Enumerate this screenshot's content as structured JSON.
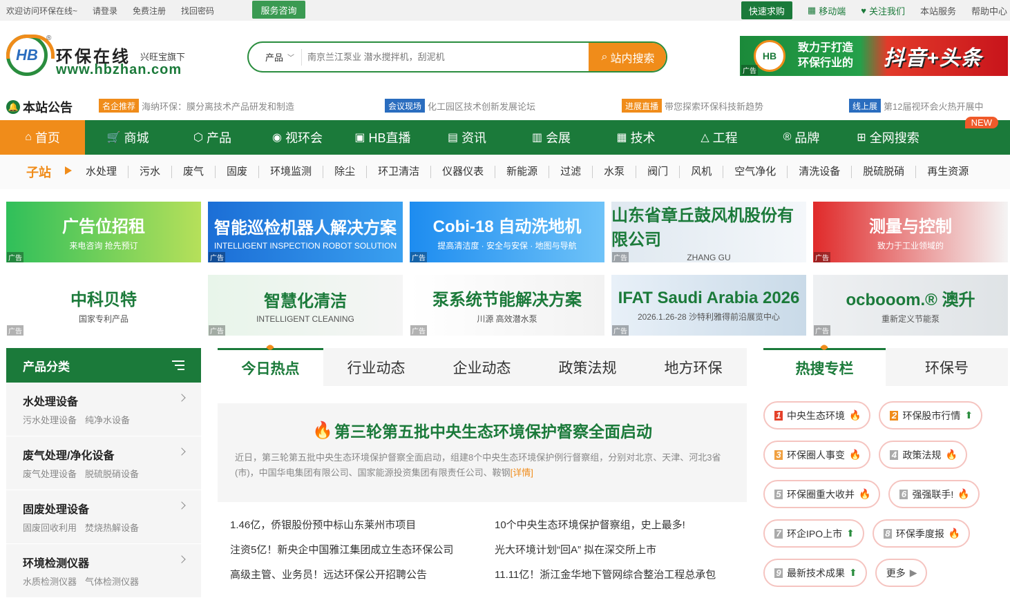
{
  "topbar": {
    "welcome": "欢迎访问环保在线~",
    "login": "请登录",
    "register": "免费注册",
    "find_pwd": "找回密码",
    "service": "服务咨询",
    "quick_buy": "快速求购",
    "mobile": "移动端",
    "follow": "关注我们",
    "site_service": "本站服务",
    "help": "帮助中心"
  },
  "logo": {
    "mark": "HB",
    "cn": "环保在线",
    "sub": "兴旺宝旗下",
    "url": "www.hbzhan.com"
  },
  "search": {
    "category": "产品",
    "placeholder": "南京兰江泵业 潜水搅拌机，刮泥机",
    "button": "站内搜索"
  },
  "top_banner": {
    "badge": "HB",
    "line1": "致力于打造",
    "line2": "环保行业的",
    "slogan": "抖音+头条",
    "ad": "广告"
  },
  "notice": {
    "title": "本站公告",
    "items": [
      {
        "tag": "名企推荐",
        "text": "海纳环保：膜分离技术产品研发和制造",
        "color": "#f08c1a"
      },
      {
        "tag": "会议现场",
        "text": "化工园区技术创新发展论坛",
        "color": "#2a6dbf"
      },
      {
        "tag": "进展直播",
        "text": "带您探索环保科技新趋势",
        "color": "#f08c1a"
      },
      {
        "tag": "线上展",
        "text": "第12届视环会火热开展中",
        "color": "#2a6dbf"
      }
    ]
  },
  "nav": {
    "items": [
      "首页",
      "商城",
      "产品",
      "视环会",
      "HB直播",
      "资讯",
      "会展",
      "技术",
      "工程",
      "品牌",
      "全网搜索"
    ],
    "new_badge": "NEW"
  },
  "subnav": {
    "label": "子站",
    "items": [
      "水处理",
      "污水",
      "废气",
      "固废",
      "环境监测",
      "除尘",
      "环卫清洁",
      "仪器仪表",
      "新能源",
      "过滤",
      "水泵",
      "阀门",
      "风机",
      "空气净化",
      "清洗设备",
      "脱硫脱硝",
      "再生资源"
    ]
  },
  "ads": [
    [
      {
        "t1": "广告位招租",
        "t2": "来电咨询 抢先预订",
        "bg": "linear-gradient(90deg,#2fbf5a,#b6e05a)"
      },
      {
        "t1": "智能巡检机器人解决方案",
        "t2": "INTELLIGENT INSPECTION ROBOT SOLUTION",
        "bg": "linear-gradient(90deg,#1b6ed6,#3aa0f0)"
      },
      {
        "t1": "Cobi-18 自动洗地机",
        "t2": "提高清洁度 · 安全与安保 · 地图与导航",
        "bg": "linear-gradient(90deg,#1d8cf0,#6fc3f8)"
      },
      {
        "t1": "山东省章丘鼓风机股份有限公司",
        "t2": "ZHANG GU",
        "bg": "linear-gradient(90deg,#dfe8f0,#f4f7fa)",
        "dark": true
      },
      {
        "t1": "测量与控制",
        "t2": "致力于工业领域的",
        "bg": "linear-gradient(90deg,#e02a2a,#f4f4f4)"
      }
    ],
    [
      {
        "t1": "中科贝特",
        "t2": "国家专利产品",
        "bg": "linear-gradient(90deg,#ffffff,#ffffff)",
        "dark": true
      },
      {
        "t1": "智慧化清洁",
        "t2": "INTELLIGENT CLEANING",
        "bg": "linear-gradient(90deg,#e8f5ea,#f5f5f5)",
        "dark": true
      },
      {
        "t1": "泵系统节能解决方案",
        "t2": "川源 高效潜水泵",
        "bg": "linear-gradient(90deg,#ffffff,#f2f2f2)",
        "dark": true
      },
      {
        "t1": "IFAT Saudi Arabia 2026",
        "t2": "2026.1.26-28 沙特利雅得前沿展览中心",
        "bg": "linear-gradient(90deg,#e8f0f8,#c9dae8)",
        "dark": true
      },
      {
        "t1": "ocbooom.® 澳升",
        "t2": "重新定义节能泵",
        "bg": "linear-gradient(90deg,#eef0f2,#dfe3e6)",
        "dark": true
      }
    ]
  ],
  "ad_label": "广告",
  "category": {
    "title": "产品分类",
    "rows": [
      {
        "t": "水处理设备",
        "s1": "污水处理设备",
        "s2": "纯净水设备"
      },
      {
        "t": "废气处理/净化设备",
        "s1": "废气处理设备",
        "s2": "脱硫脱硝设备"
      },
      {
        "t": "固废处理设备",
        "s1": "固废回收利用",
        "s2": "焚烧热解设备"
      },
      {
        "t": "环境检测仪器",
        "s1": "水质检测仪器",
        "s2": "气体检测仪器"
      }
    ]
  },
  "news": {
    "tabs": [
      "今日热点",
      "行业动态",
      "企业动态",
      "政策法规",
      "地方环保"
    ],
    "headline": "第三轮第五批中央生态环境保护督察全面启动",
    "summary": "近日，第三轮第五批中央生态环境保护督察全面启动，组建8个中央生态环境保护例行督察组，分别对北京、天津、河北3省(市)，中国华电集团有限公司、国家能源投资集团有限责任公司、鞍钢",
    "more": "[详情]",
    "items": [
      "1.46亿，侨银股份预中标山东莱州市项目",
      "10个中央生态环境保护督察组，史上最多!",
      "注资5亿！新央企中国雅江集团成立生态环保公司",
      "光大环境计划“回A” 拟在深交所上市",
      "高级主管、业务员！远达环保公开招聘公告",
      "11.11亿！浙江金华地下管网综合整治工程总承包"
    ]
  },
  "hot": {
    "tabs": [
      "热搜专栏",
      "环保号"
    ],
    "pills": [
      {
        "n": "1",
        "t": "中央生态环境",
        "i": "fire",
        "c": "#e4412a"
      },
      {
        "n": "2",
        "t": "环保股市行情",
        "i": "up",
        "c": "#f08c1a"
      },
      {
        "n": "3",
        "t": "环保圈人事变",
        "i": "fire",
        "c": "#f0a040"
      },
      {
        "n": "4",
        "t": "政策法规",
        "i": "fire",
        "c": "#aaaaaa"
      },
      {
        "n": "5",
        "t": "环保圈重大收并",
        "i": "fire",
        "c": "#aaaaaa"
      },
      {
        "n": "6",
        "t": "强强联手!",
        "i": "fire",
        "c": "#aaaaaa"
      },
      {
        "n": "7",
        "t": "环企IPO上市",
        "i": "up",
        "c": "#aaaaaa"
      },
      {
        "n": "8",
        "t": "环保季度报",
        "i": "fire",
        "c": "#aaaaaa"
      },
      {
        "n": "9",
        "t": "最新技术成果",
        "i": "up",
        "c": "#aaaaaa"
      },
      {
        "n": "",
        "t": "更多",
        "i": "more",
        "c": "#aaaaaa"
      }
    ]
  }
}
